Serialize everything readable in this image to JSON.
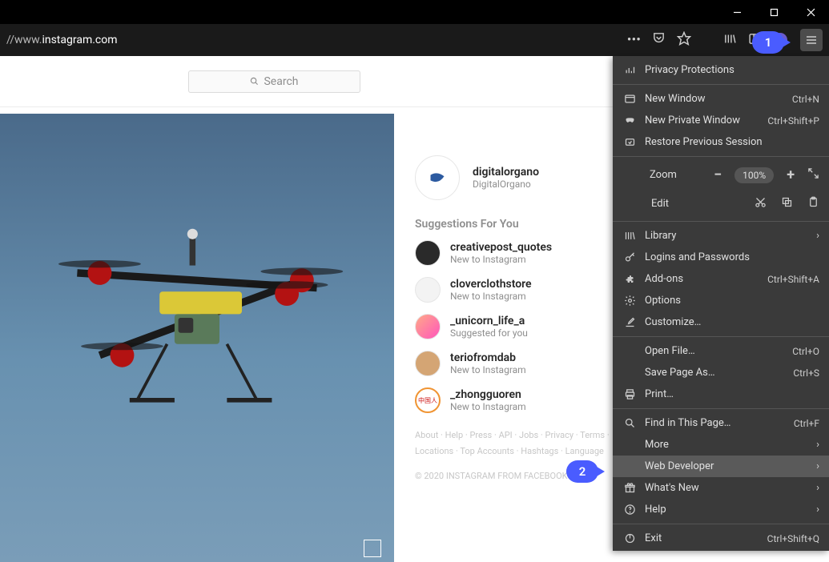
{
  "url": {
    "prefix": "//www.",
    "domain": "instagram.com",
    "suffix": ""
  },
  "callouts": {
    "one": "1",
    "two": "2"
  },
  "instagram": {
    "search_placeholder": "Search",
    "profile": {
      "username": "digitalorgano",
      "display": "DigitalOrgano"
    },
    "suggestions_title": "Suggestions For You",
    "suggestions": [
      {
        "username": "creativepost_quotes",
        "sub": "New to Instagram"
      },
      {
        "username": "cloverclothstore",
        "sub": "New to Instagram"
      },
      {
        "username": "_unicorn_life_a",
        "sub": "Suggested for you"
      },
      {
        "username": "teriofromdab",
        "sub": "New to Instagram"
      },
      {
        "username": "_zhongguoren",
        "sub": "New to Instagram"
      }
    ],
    "footer_links": "About · Help · Press · API · Jobs · Privacy · Terms · Locations · Top Accounts · Hashtags · Language",
    "footer_copy": "© 2020 INSTAGRAM FROM FACEBOOK"
  },
  "menu": {
    "privacy": "Privacy Protections",
    "new_window": {
      "label": "New Window",
      "shortcut": "Ctrl+N"
    },
    "new_private": {
      "label": "New Private Window",
      "shortcut": "Ctrl+Shift+P"
    },
    "restore": "Restore Previous Session",
    "zoom_label": "Zoom",
    "zoom_value": "100%",
    "edit_label": "Edit",
    "library": "Library",
    "logins": "Logins and Passwords",
    "addons": {
      "label": "Add-ons",
      "shortcut": "Ctrl+Shift+A"
    },
    "options": "Options",
    "customize": "Customize…",
    "open_file": {
      "label": "Open File…",
      "shortcut": "Ctrl+O"
    },
    "save_page": {
      "label": "Save Page As…",
      "shortcut": "Ctrl+S"
    },
    "print": "Print…",
    "find": {
      "label": "Find in This Page…",
      "shortcut": "Ctrl+F"
    },
    "more": "More",
    "webdev": "Web Developer",
    "whats_new": "What's New",
    "help": "Help",
    "exit": {
      "label": "Exit",
      "shortcut": "Ctrl+Shift+Q"
    }
  }
}
